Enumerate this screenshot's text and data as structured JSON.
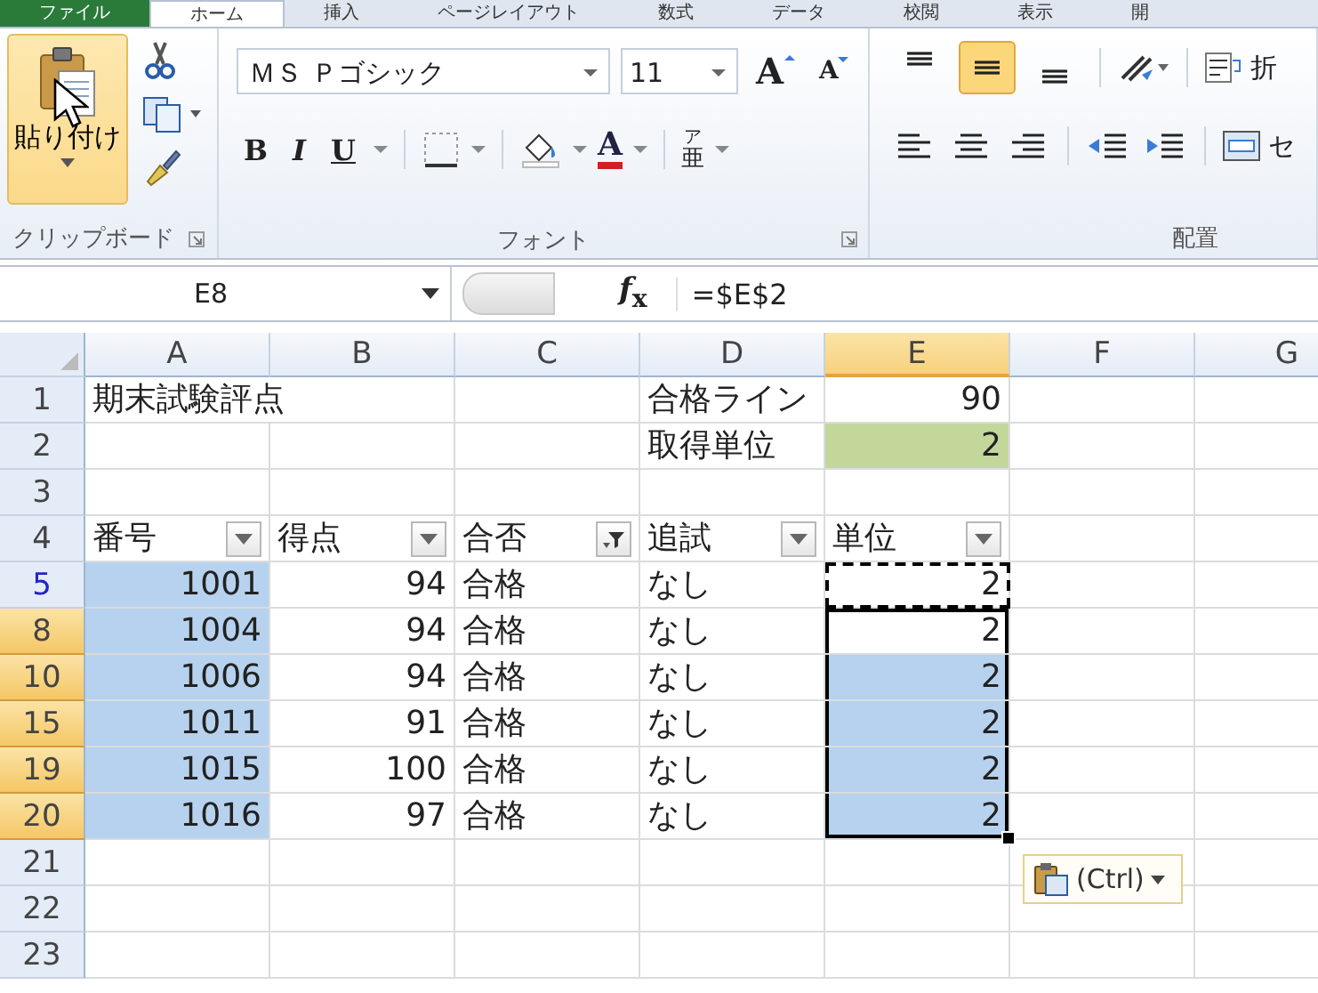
{
  "tabs": [
    {
      "label": "ファイル",
      "kind": "file",
      "selected": false
    },
    {
      "label": "ホーム",
      "kind": "tab",
      "selected": true
    },
    {
      "label": "挿入",
      "kind": "tab",
      "selected": false
    },
    {
      "label": "ページレイアウト",
      "kind": "tab",
      "selected": false
    },
    {
      "label": "数式",
      "kind": "tab",
      "selected": false
    },
    {
      "label": "データ",
      "kind": "tab",
      "selected": false
    },
    {
      "label": "校閲",
      "kind": "tab",
      "selected": false
    },
    {
      "label": "表示",
      "kind": "tab",
      "selected": false
    },
    {
      "label": "開",
      "kind": "tab",
      "selected": false
    }
  ],
  "ribbon": {
    "clipboard": {
      "label": "クリップボード",
      "paste_label": "貼り付け"
    },
    "font": {
      "label": "フォント",
      "font_name": "ＭＳ Ｐゴシック",
      "font_size": "11",
      "grow": "A",
      "shrink": "A",
      "bold": "B",
      "italic": "I",
      "underline": "U",
      "font_color": "A",
      "phonetic": "亜",
      "phonetic_ruby": "ア"
    },
    "alignment": {
      "label": "配置",
      "vertical": [
        {
          "kind": "top",
          "selected": false
        },
        {
          "kind": "middle",
          "selected": true
        },
        {
          "kind": "bottom",
          "selected": false
        }
      ],
      "wrap_label": "折",
      "merge_label": "セ"
    }
  },
  "formula_bar": {
    "name_box": "E8",
    "function_label": "*f*$_{x}$",
    "formula": "=$E$2"
  },
  "sheet": {
    "columns": [
      {
        "label": "A",
        "selected": false
      },
      {
        "label": "B",
        "selected": false
      },
      {
        "label": "C",
        "selected": false
      },
      {
        "label": "D",
        "selected": false
      },
      {
        "label": "E",
        "selected": true
      },
      {
        "label": "F",
        "selected": false
      },
      {
        "label": "G",
        "selected": false
      }
    ],
    "rows": [
      {
        "label": "1",
        "selected": false,
        "filtered": false,
        "cells": [
          {
            "text": "期末試験評点",
            "kind": "text"
          },
          {},
          {},
          {
            "text": "合格ライン",
            "kind": "text"
          },
          {
            "text": "90",
            "kind": "number"
          },
          {},
          {}
        ]
      },
      {
        "label": "2",
        "selected": false,
        "filtered": false,
        "cells": [
          {},
          {},
          {},
          {
            "text": "取得単位",
            "kind": "text"
          },
          {
            "text": "2",
            "kind": "number",
            "color": "#c4d79b"
          },
          {},
          {}
        ]
      },
      {
        "label": "3",
        "selected": false,
        "filtered": false,
        "cells": [
          {},
          {},
          {},
          {},
          {},
          {},
          {}
        ]
      },
      {
        "label": "4",
        "selected": false,
        "filtered": false,
        "cells": [
          {
            "text": "番号",
            "kind": "text",
            "filter_active": false
          },
          {
            "text": "得点",
            "kind": "text",
            "filter_active": false
          },
          {
            "text": "合否",
            "kind": "text",
            "filter_active": true
          },
          {
            "text": "追試",
            "kind": "text",
            "filter_active": false
          },
          {
            "text": "単位",
            "kind": "text",
            "filter_active": false
          },
          {},
          {}
        ]
      },
      {
        "label": "5",
        "selected": false,
        "filtered": true,
        "cells": [
          {
            "text": "1001",
            "kind": "number",
            "selected": true
          },
          {
            "text": "94",
            "kind": "number"
          },
          {
            "text": "合格",
            "kind": "text"
          },
          {
            "text": "なし",
            "kind": "text"
          },
          {
            "text": "2",
            "kind": "number",
            "copied": true
          },
          {},
          {}
        ]
      },
      {
        "label": "8",
        "selected": true,
        "filtered": true,
        "cells": [
          {
            "text": "1004",
            "kind": "number",
            "selected": true
          },
          {
            "text": "94",
            "kind": "number"
          },
          {
            "text": "合格",
            "kind": "text"
          },
          {
            "text": "なし",
            "kind": "text"
          },
          {
            "text": "2",
            "kind": "number",
            "in_range": true
          },
          {},
          {}
        ]
      },
      {
        "label": "10",
        "selected": true,
        "filtered": true,
        "cells": [
          {
            "text": "1006",
            "kind": "number",
            "selected": true
          },
          {
            "text": "94",
            "kind": "number"
          },
          {
            "text": "合格",
            "kind": "text"
          },
          {
            "text": "なし",
            "kind": "text"
          },
          {
            "text": "2",
            "kind": "number",
            "selected": true,
            "in_range": true
          },
          {},
          {}
        ]
      },
      {
        "label": "15",
        "selected": true,
        "filtered": true,
        "cells": [
          {
            "text": "1011",
            "kind": "number",
            "selected": true
          },
          {
            "text": "91",
            "kind": "number"
          },
          {
            "text": "合格",
            "kind": "text"
          },
          {
            "text": "なし",
            "kind": "text"
          },
          {
            "text": "2",
            "kind": "number",
            "selected": true,
            "in_range": true
          },
          {},
          {}
        ]
      },
      {
        "label": "19",
        "selected": true,
        "filtered": true,
        "cells": [
          {
            "text": "1015",
            "kind": "number",
            "selected": true
          },
          {
            "text": "100",
            "kind": "number"
          },
          {
            "text": "合格",
            "kind": "text"
          },
          {
            "text": "なし",
            "kind": "text"
          },
          {
            "text": "2",
            "kind": "number",
            "selected": true,
            "in_range": true
          },
          {},
          {}
        ]
      },
      {
        "label": "20",
        "selected": true,
        "filtered": true,
        "cells": [
          {
            "text": "1016",
            "kind": "number",
            "selected": true
          },
          {
            "text": "97",
            "kind": "number"
          },
          {
            "text": "合格",
            "kind": "text"
          },
          {
            "text": "なし",
            "kind": "text"
          },
          {
            "text": "2",
            "kind": "number",
            "selected": true,
            "in_range": true
          },
          {},
          {}
        ]
      },
      {
        "label": "21",
        "selected": false,
        "filtered": false,
        "cells": [
          {},
          {},
          {},
          {},
          {},
          {},
          {}
        ]
      },
      {
        "label": "22",
        "selected": false,
        "filtered": false,
        "cells": [
          {},
          {},
          {},
          {},
          {},
          {},
          {}
        ]
      },
      {
        "label": "23",
        "selected": false,
        "filtered": false,
        "cells": [
          {},
          {},
          {},
          {},
          {},
          {},
          {}
        ]
      }
    ],
    "paste_options": {
      "label": "(Ctrl)"
    }
  }
}
